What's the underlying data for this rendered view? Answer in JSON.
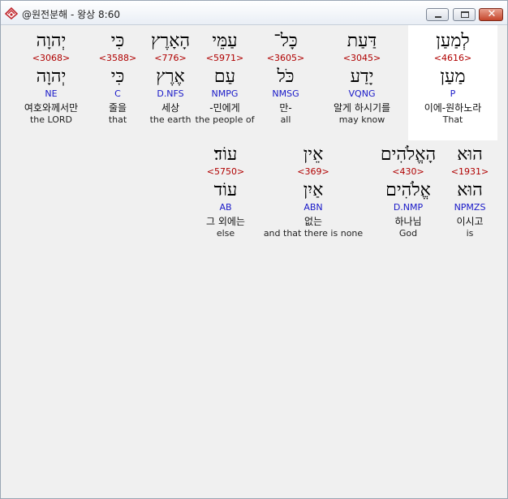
{
  "window": {
    "title": "@원전분해 - 왕상 8:60",
    "app_icon": "bible-app-icon",
    "controls": {
      "minimize": "minimize-icon",
      "maximize": "maximize-icon",
      "close": "close-icon"
    }
  },
  "row1": [
    {
      "hebrew": "לְמַעַן",
      "strong": "<4616>",
      "lemma": "מַעַן",
      "parse": "P",
      "korean": "이에-원하노라",
      "english": "That",
      "selected": true
    },
    {
      "hebrew": "דַּעַת",
      "strong": "<3045>",
      "lemma": "יָדַע",
      "parse": "VQNG",
      "korean": "알게 하시기를",
      "english": "may know",
      "selected": false
    },
    {
      "hebrew": "כָּל־",
      "strong": "<3605>",
      "lemma": "כֹּל",
      "parse": "NMSG",
      "korean": "만-",
      "english": "all",
      "selected": false
    },
    {
      "hebrew": "עַמֵּי",
      "strong": "<5971>",
      "lemma": "עַם",
      "parse": "NMPG",
      "korean": "-민에게",
      "english": "the people of",
      "selected": false
    },
    {
      "hebrew": "הָאָרֶץ",
      "strong": "<776>",
      "lemma": "אֶרֶץ",
      "parse": "D.NFS",
      "korean": "세상",
      "english": "the earth",
      "selected": false
    },
    {
      "hebrew": "כִּי",
      "strong": "<3588>",
      "lemma": "כִּי",
      "parse": "C",
      "korean": "줄을",
      "english": "that",
      "selected": false
    },
    {
      "hebrew": "יְהוָה",
      "strong": "<3068>",
      "lemma": "יְהוָה",
      "parse": "NE",
      "korean": "여호와께서만",
      "english": "the LORD",
      "selected": false
    }
  ],
  "row2": [
    {
      "hebrew": "הוּא",
      "strong": "<1931>",
      "lemma": "הוּא",
      "parse": "NPMZS",
      "korean": "이시고",
      "english": "is",
      "selected": false
    },
    {
      "hebrew": "הָאֱלֹהִים",
      "strong": "<430>",
      "lemma": "אֱלֹהִים",
      "parse": "D.NMP",
      "korean": "하나님",
      "english": "God",
      "selected": false
    },
    {
      "hebrew": "אֵין",
      "strong": "<369>",
      "lemma": "אַיִן",
      "parse": "ABN",
      "korean": "없는",
      "english": "and that there is none",
      "selected": false
    },
    {
      "hebrew": "עוֹד׃",
      "strong": "<5750>",
      "lemma": "עוֹד",
      "parse": "AB",
      "korean": "그 외에는",
      "english": "else",
      "selected": false
    }
  ]
}
